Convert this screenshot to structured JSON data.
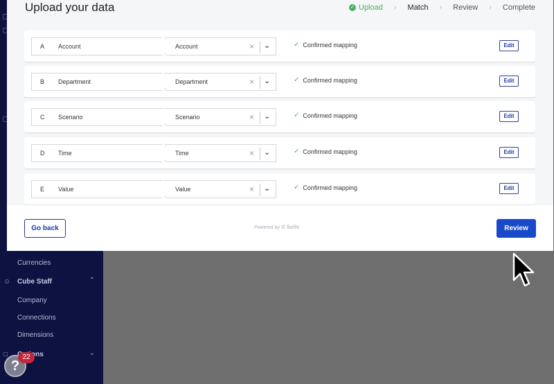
{
  "modal": {
    "title": "Upload your data",
    "steps": [
      {
        "label": "Upload",
        "state": "done"
      },
      {
        "label": "Match",
        "state": "active"
      },
      {
        "label": "Review",
        "state": "pending"
      },
      {
        "label": "Complete",
        "state": "pending"
      }
    ],
    "rows": [
      {
        "letter": "A",
        "source": "Account",
        "target": "Account",
        "status": "Confirmed mapping",
        "edit": "Edit"
      },
      {
        "letter": "B",
        "source": "Department",
        "target": "Department",
        "status": "Confirmed mapping",
        "edit": "Edit"
      },
      {
        "letter": "C",
        "source": "Scenario",
        "target": "Scenario",
        "status": "Confirmed mapping",
        "edit": "Edit"
      },
      {
        "letter": "D",
        "source": "Time",
        "target": "Time",
        "status": "Confirmed mapping",
        "edit": "Edit"
      },
      {
        "letter": "E",
        "source": "Value",
        "target": "Value",
        "status": "Confirmed mapping",
        "edit": "Edit"
      }
    ],
    "footer": {
      "back_label": "Go back",
      "powered_by": "Powered by",
      "brand": "flatfile",
      "review_label": "Review"
    }
  },
  "sidebar": {
    "currencies": "Currencies",
    "cube_staff": "Cube Staff",
    "company": "Company",
    "connections": "Connections",
    "dimensions": "Dimensions",
    "options": "Options"
  },
  "help": {
    "badge_count": "22",
    "glyph": "?"
  }
}
